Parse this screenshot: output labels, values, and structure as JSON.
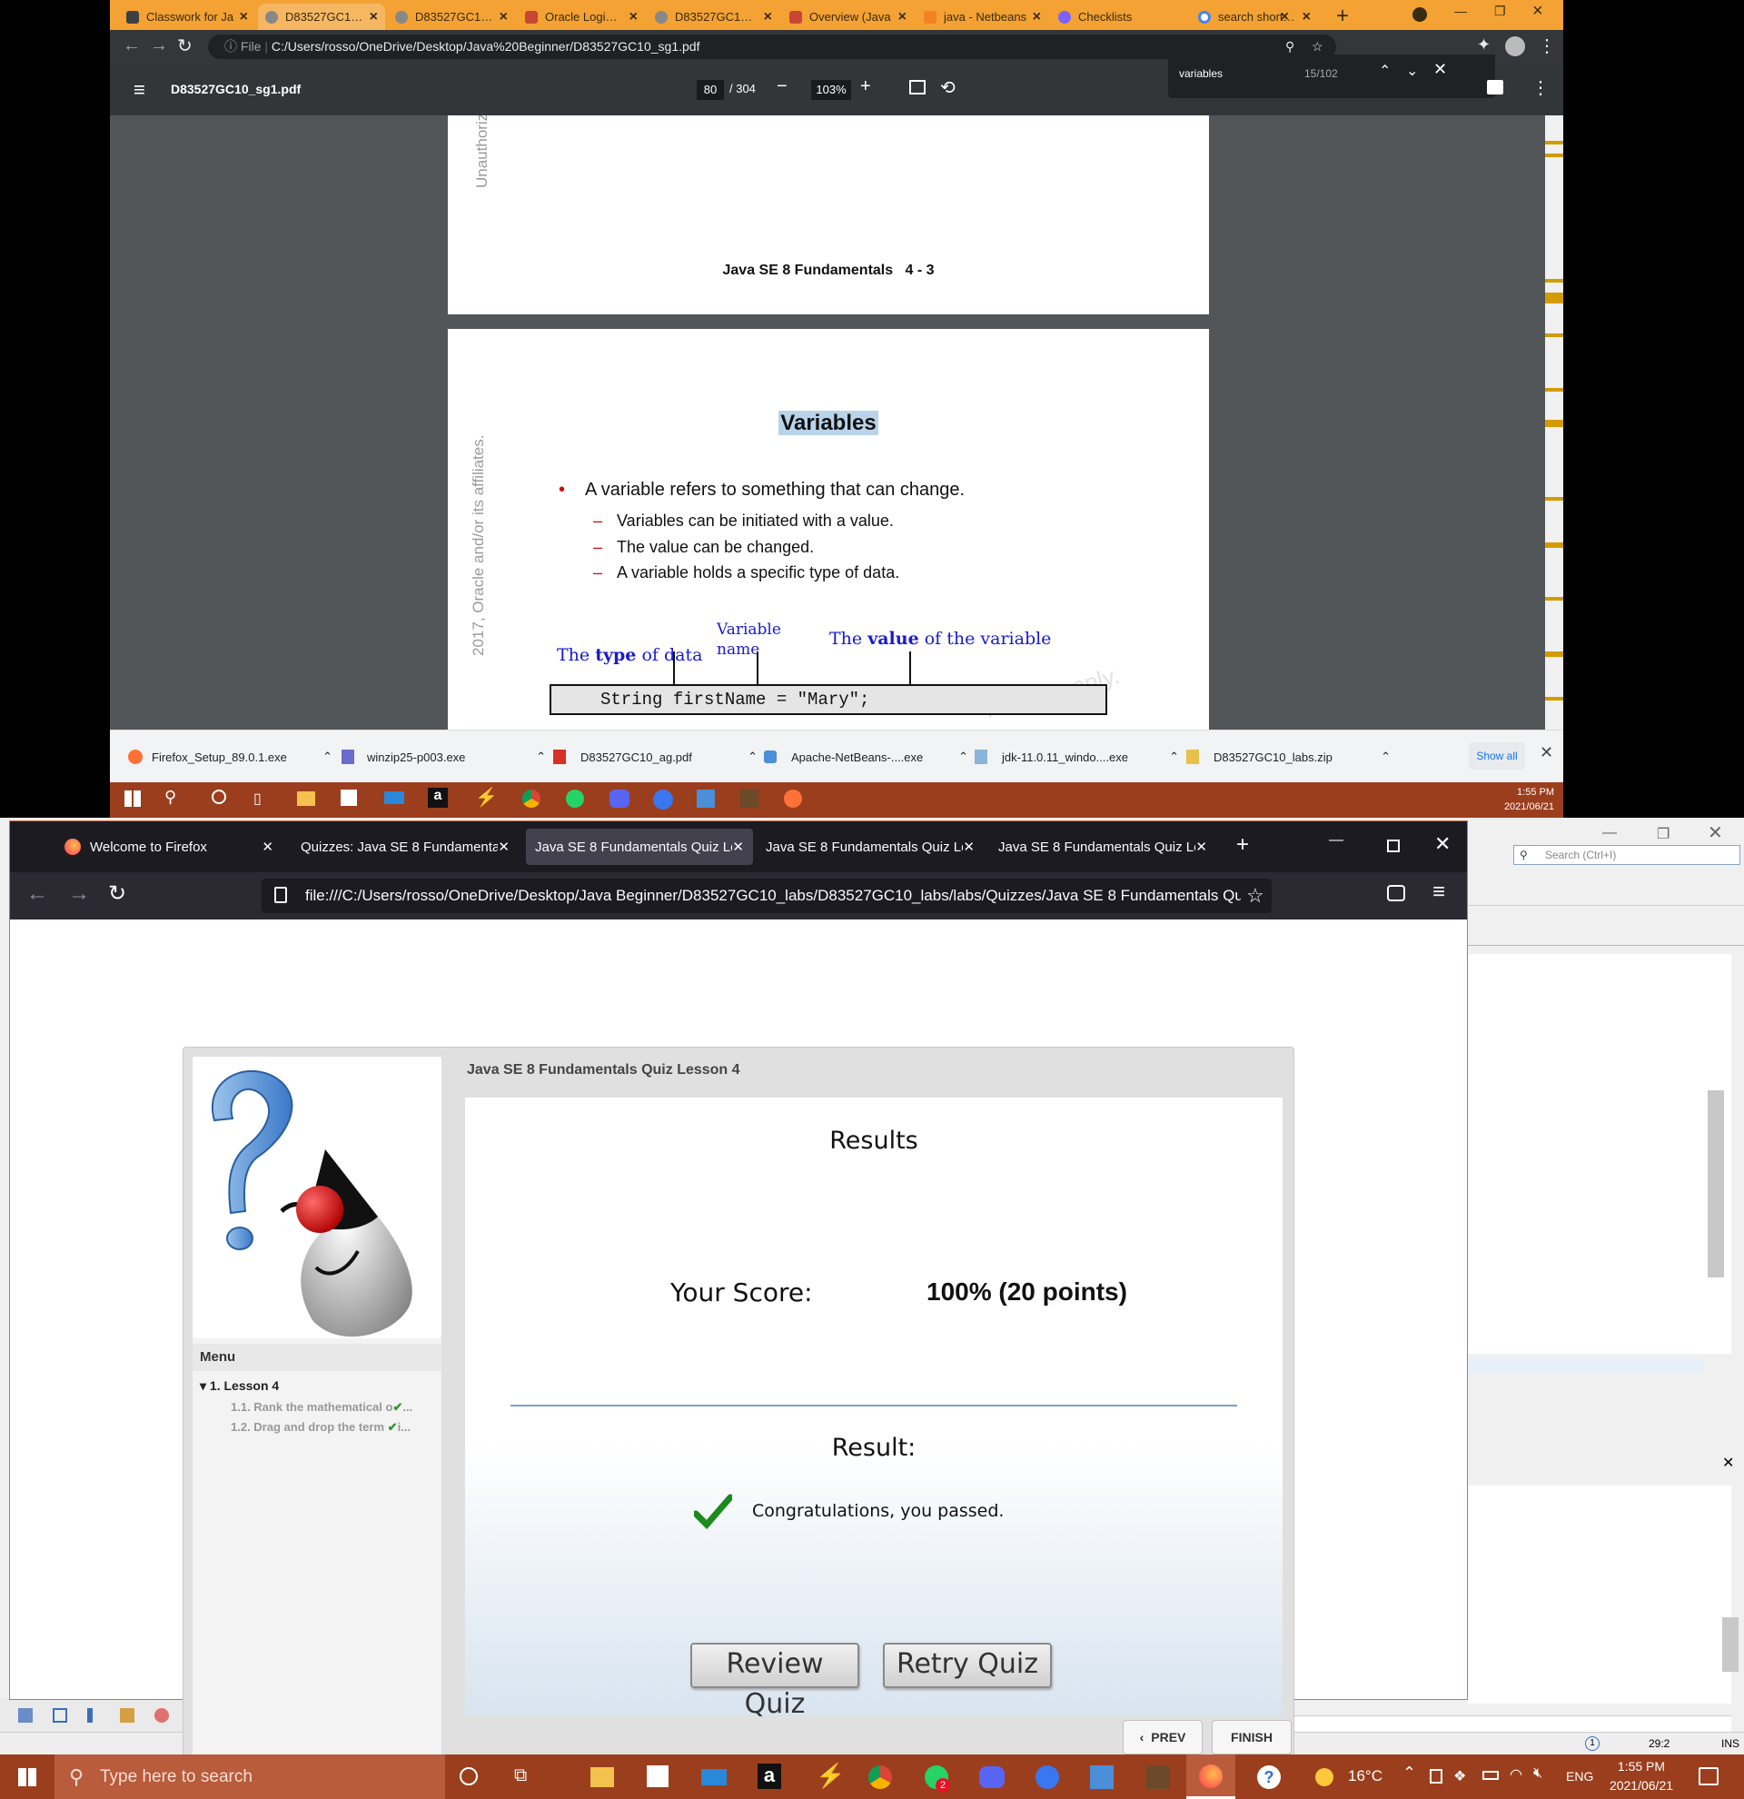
{
  "chrome": {
    "tabs": [
      {
        "label": "Classwork for Ja",
        "color": "#3c4043"
      },
      {
        "label": "D83527GC10_sg",
        "color": "#5f6368"
      },
      {
        "label": "D83527GC10_sg",
        "color": "#5f6368"
      },
      {
        "label": "Oracle Login - R",
        "color": "#c74634"
      },
      {
        "label": "D83527GC10_ag",
        "color": "#5f6368"
      },
      {
        "label": "Overview (Java",
        "color": "#c74634"
      },
      {
        "label": "java - Netbeans",
        "color": "#f48024"
      },
      {
        "label": "Checklists",
        "color": "#7b61ff"
      },
      {
        "label": "search shortcut",
        "color": "#4285f4"
      }
    ],
    "url_scheme": "File",
    "url": "C:/Users/rosso/OneDrive/Desktop/Java%20Beginner/D83527GC10_sg1.pdf",
    "pdf": {
      "file_name": "D83527GC10_sg1.pdf",
      "page_current": "80",
      "page_total": "/ 304",
      "zoom": "103%",
      "find_query": "variables",
      "find_count": "15/102"
    },
    "slide_footer": "Java SE 8 Fundamentals   4 - 3",
    "watermark_top": "Unauthoriz",
    "watermark_side": "2017, Oracle and/or its affiliates.",
    "watermark_diag": "nce use only.",
    "slide": {
      "title": "Variables",
      "bullet": "A variable refers to something that can change.",
      "subs": [
        "Variables can be initiated with a value.",
        "The value can be changed.",
        "A variable holds a specific type of data."
      ],
      "ann_type_pre": "The ",
      "ann_type_bold": "type",
      "ann_type_post": " of data",
      "ann_name_1": "Variable",
      "ann_name_2": "name",
      "ann_value_pre": "The ",
      "ann_value_bold": "value",
      "ann_value_post": " of the variable",
      "code": "String firstName = \"Mary\";"
    },
    "downloads": [
      "Firefox_Setup_89.0.1.exe",
      "winzip25-p003.exe",
      "D83527GC10_ag.pdf",
      "Apache-NetBeans-....exe",
      "jdk-11.0.11_windo....exe",
      "D83527GC10_labs.zip"
    ],
    "show_all": "Show all",
    "clock_time": "1:55 PM",
    "clock_date": "2021/06/21"
  },
  "netbeans": {
    "search_placeholder": "Search (Ctrl+I)",
    "status_pos": "29:2",
    "status_mode": "INS",
    "status_badge": "1"
  },
  "firefox": {
    "tabs": [
      "Welcome to Firefox",
      "Quizzes: Java SE 8 Fundamentals",
      "Java SE 8 Fundamentals Quiz Le",
      "Java SE 8 Fundamentals Quiz Le",
      "Java SE 8 Fundamentals Quiz Le"
    ],
    "url": "file:///C:/Users/rosso/OneDrive/Desktop/Java Beginner/D83527GC10_labs/D83527GC10_labs/labs/Quizzes/Java SE 8 Fundamentals Qu"
  },
  "quiz": {
    "header": "Java SE 8 Fundamentals Quiz Lesson 4",
    "menu_title": "Menu",
    "lesson": "1. Lesson 4",
    "items": [
      "1.1. Rank the mathematical o",
      "1.2. Drag and drop the term "
    ],
    "results_title": "Results",
    "score_label": "Your Score:",
    "score_value": "100% (20 points)",
    "result_label": "Result:",
    "result_message": "Congratulations, you passed.",
    "review_button": "Review Quiz",
    "retry_button": "Retry Quiz",
    "prev_button": "PREV",
    "finish_button": "FINISH"
  },
  "taskbar": {
    "search_placeholder": "Type here to search",
    "temperature": "16°C",
    "language": "ENG",
    "time": "1:55 PM",
    "date": "2021/06/21",
    "whatsapp_badge": "2"
  }
}
